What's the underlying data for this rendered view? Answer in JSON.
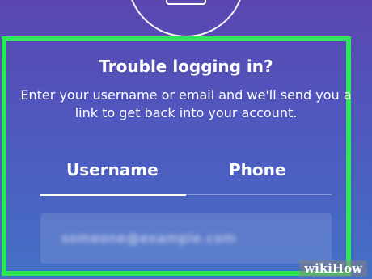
{
  "header": {
    "title": "Trouble logging in?",
    "description": "Enter your username or email and we'll send you a link to get back into your account."
  },
  "tabs": [
    {
      "label": "Username",
      "active": true
    },
    {
      "label": "Phone",
      "active": false
    }
  ],
  "input": {
    "value": "someone@example.com",
    "obscured": true
  },
  "watermark": {
    "part1": "wiki",
    "part2": "How"
  },
  "colors": {
    "highlight_frame": "#2ee65a",
    "background_top": "#5b46b0",
    "background_bottom": "#4470c6"
  }
}
